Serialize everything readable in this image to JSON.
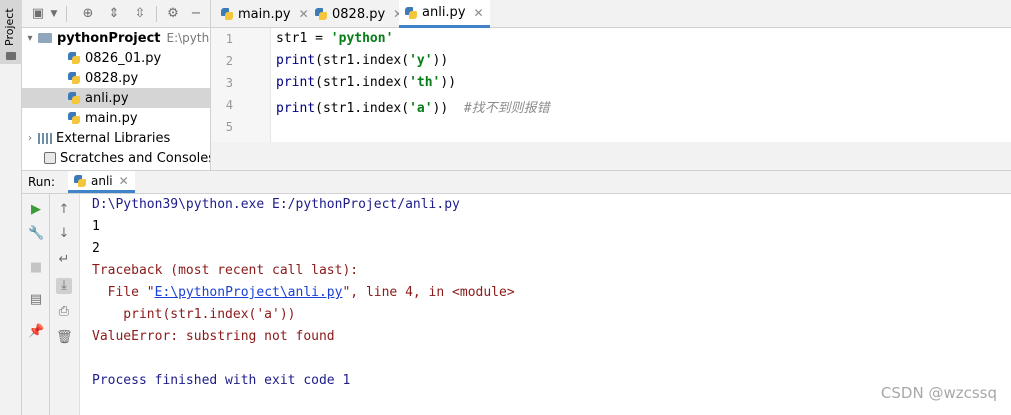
{
  "tool_strip": {
    "project_label": "Project"
  },
  "tabs": [
    {
      "label": "main.py",
      "active": false
    },
    {
      "label": "0828.py",
      "active": false
    },
    {
      "label": "anli.py",
      "active": true
    }
  ],
  "tree": {
    "root": {
      "name": "pythonProject",
      "path": "E:\\pytho"
    },
    "files": [
      "0826_01.py",
      "0828.py",
      "anli.py",
      "main.py"
    ],
    "selected": "anli.py",
    "external_libraries": "External Libraries",
    "scratches": "Scratches and Consoles"
  },
  "editor": {
    "line_numbers": [
      "1",
      "2",
      "3",
      "4",
      "5"
    ],
    "lines": [
      {
        "pre": "str1 = ",
        "fn": "",
        "mid": "",
        "str": "'python'",
        "post": "",
        "comment": ""
      },
      {
        "pre": "",
        "fn": "print",
        "mid": "(str1.index(",
        "str": "'y'",
        "post": "))",
        "comment": ""
      },
      {
        "pre": "",
        "fn": "print",
        "mid": "(str1.index(",
        "str": "'th'",
        "post": "))",
        "comment": ""
      },
      {
        "pre": "",
        "fn": "print",
        "mid": "(str1.index(",
        "str": "'a'",
        "post": "))  ",
        "comment": "#找不到则报错"
      }
    ]
  },
  "run": {
    "label": "Run:",
    "tab": "anli",
    "console": {
      "command": "D:\\Python39\\python.exe E:/pythonProject/anli.py",
      "out1": "1",
      "out2": "2",
      "traceback": "Traceback (most recent call last):",
      "file_prefix": "  File \"",
      "file_link": "E:\\pythonProject\\anli.py",
      "file_suffix": "\", line 4, in <module>",
      "code": "    print(str1.index('a'))",
      "error": "ValueError: substring not found",
      "exit": "Process finished with exit code 1"
    }
  },
  "watermark": "CSDN @wzcssq",
  "colors": {
    "accent": "#4083c9",
    "string": "#067d17",
    "error": "#8b1a1a",
    "link": "#1a3fd8"
  }
}
